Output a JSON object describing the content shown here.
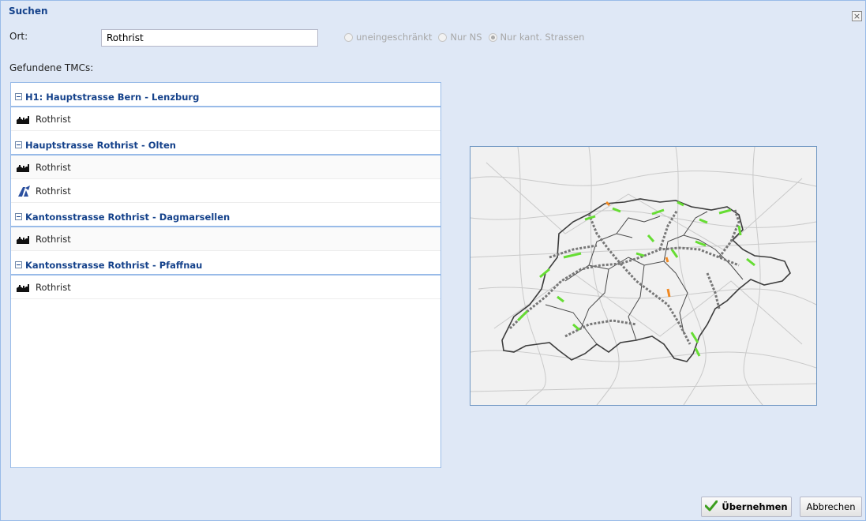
{
  "dialog": {
    "title": "Suchen",
    "close_label": "×"
  },
  "search": {
    "ort_label": "Ort:",
    "ort_value": "Rothrist",
    "options": [
      {
        "label": "uneingeschränkt",
        "checked": false
      },
      {
        "label": "Nur NS",
        "checked": false
      },
      {
        "label": "Nur kant. Strassen",
        "checked": true
      }
    ]
  },
  "results": {
    "label": "Gefundene TMCs:",
    "groups": [
      {
        "title": "H1: Hauptstrasse Bern - Lenzburg",
        "items": [
          {
            "icon": "town-icon",
            "label": "Rothrist"
          }
        ]
      },
      {
        "title": "Hauptstrasse Rothrist - Olten",
        "items": [
          {
            "icon": "town-icon",
            "label": "Rothrist"
          },
          {
            "icon": "junction-icon",
            "label": "Rothrist"
          }
        ]
      },
      {
        "title": "Kantonsstrasse Rothrist - Dagmarsellen",
        "items": [
          {
            "icon": "town-icon",
            "label": "Rothrist"
          }
        ]
      },
      {
        "title": "Kantonsstrasse Rothrist - Pfaffnau",
        "items": [
          {
            "icon": "town-icon",
            "label": "Rothrist"
          }
        ]
      }
    ]
  },
  "buttons": {
    "apply_label": "Übernehmen",
    "cancel_label": "Abbrechen"
  },
  "colors": {
    "header_text": "#15428b",
    "panel_border": "#99bbe8",
    "dialog_bg": "#dfe8f6",
    "road_green": "#66dd33",
    "road_orange": "#f08a24",
    "check_green": "#3c9e1e"
  }
}
